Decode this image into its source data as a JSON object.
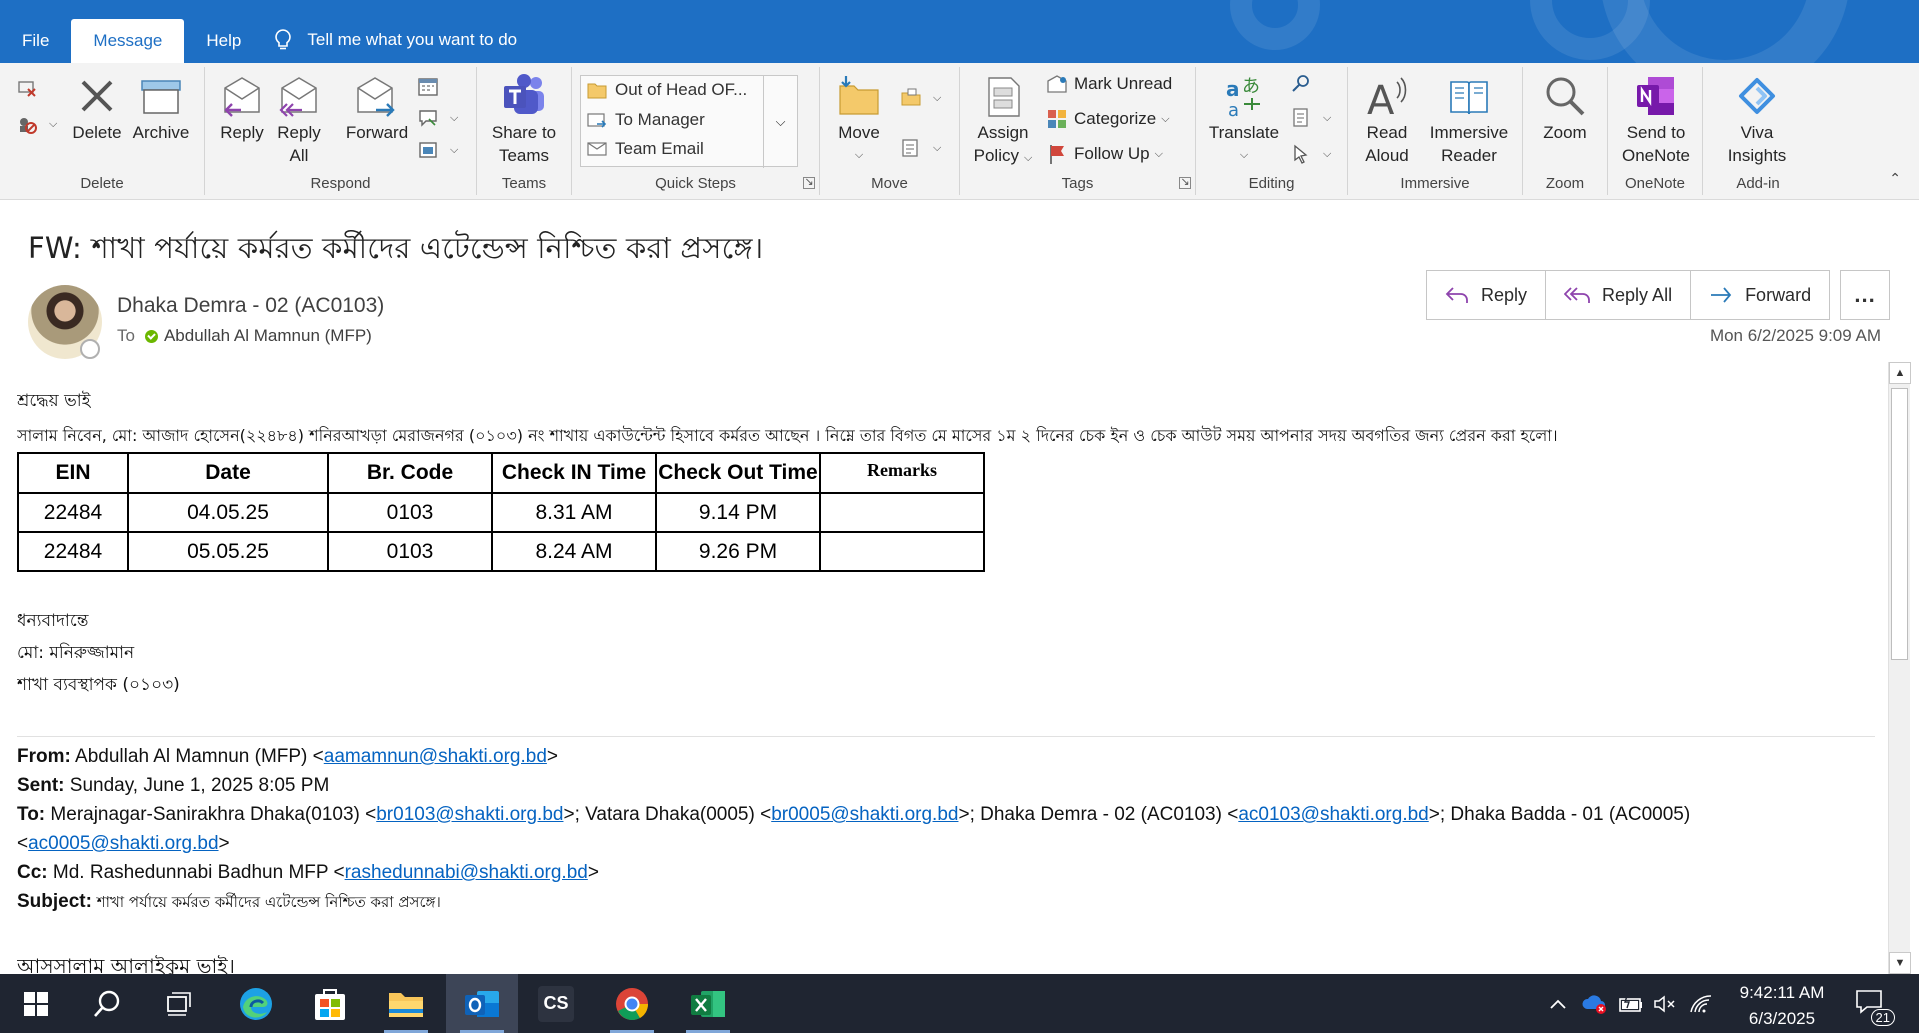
{
  "menu": {
    "file": "File",
    "message": "Message",
    "help": "Help",
    "tell_me": "Tell me what you want to do"
  },
  "ribbon": {
    "delete_group": {
      "label": "Delete",
      "delete": "Delete",
      "archive": "Archive"
    },
    "respond_group": {
      "label": "Respond",
      "reply": "Reply",
      "reply_all_1": "Reply",
      "reply_all_2": "All",
      "forward": "Forward"
    },
    "teams_group": {
      "label": "Teams",
      "share_1": "Share to",
      "share_2": "Teams"
    },
    "quick_steps_group": {
      "label": "Quick Steps",
      "items": [
        "Out of Head OF...",
        "To Manager",
        "Team Email"
      ]
    },
    "move_group": {
      "label": "Move",
      "move": "Move"
    },
    "tags_group": {
      "label": "Tags",
      "assign_1": "Assign",
      "assign_2": "Policy",
      "mark_unread": "Mark Unread",
      "categorize": "Categorize",
      "follow_up": "Follow Up"
    },
    "editing_group": {
      "label": "Editing",
      "translate": "Translate"
    },
    "immersive_group": {
      "label": "Immersive",
      "read_1": "Read",
      "read_2": "Aloud",
      "reader_1": "Immersive",
      "reader_2": "Reader"
    },
    "zoom_group": {
      "label": "Zoom",
      "zoom": "Zoom"
    },
    "onenote_group": {
      "label": "OneNote",
      "send_1": "Send to",
      "send_2": "OneNote"
    },
    "addin_group": {
      "label": "Add-in",
      "viva_1": "Viva",
      "viva_2": "Insights"
    }
  },
  "message": {
    "subject": "FW: শাখা পর্যায়ে কর্মরত কর্মীদের এটেন্ডেন্স নিশ্চিত করা প্রসঙ্গে।",
    "sender": "Dhaka Demra - 02 (AC0103)",
    "to_label": "To",
    "to": "Abdullah Al Mamnun (MFP)",
    "date": "Mon 6/2/2025 9:09 AM",
    "actions": {
      "reply": "Reply",
      "reply_all": "Reply All",
      "forward": "Forward",
      "more": "..."
    }
  },
  "body": {
    "greeting": "শ্রদ্ধেয় ভাই",
    "intro": "সালাম নিবেন, মো: আজাদ হোসেন(২২৪৮৪) শনিরআখড়া মেরাজনগর (০১০৩) নং শাখায় একাউন্টেন্ট হিসাবে কর্মরত আছেন । নিম্নে তার বিগত মে মাসের ১ম ২ দিনের চেক ইন ও চেক আউট সময় আপনার সদয় অবগতির জন্য প্রেরন করা হলো।",
    "table": {
      "headers": [
        "EIN",
        "Date",
        "Br. Code",
        "Check IN Time",
        "Check Out Time",
        "Remarks"
      ],
      "rows": [
        [
          "22484",
          "04.05.25",
          "0103",
          "8.31 AM",
          "9.14 PM",
          ""
        ],
        [
          "22484",
          "05.05.25",
          "0103",
          "8.24 AM",
          "9.26 PM",
          ""
        ]
      ]
    },
    "thanks": "ধন্যবাদান্তে",
    "signer": "মো: মনিরুজ্জামান",
    "signer_title": "শাখা ব্যবস্থাপক (০১০৩)",
    "fwd": {
      "from_label": "From:",
      "from_name": " Abdullah Al Mamnun (MFP) <",
      "from_email": "aamamnun@shakti.org.bd",
      "sent_label": "Sent:",
      "sent_value": " Sunday, June 1, 2025 8:05 PM",
      "to_label": "To:",
      "to_1_name": " Merajnagar-Sanirakhra Dhaka(0103) <",
      "to_1_email": "br0103@shakti.org.bd",
      "to_2_name": ">; Vatara Dhaka(0005) <",
      "to_2_email": "br0005@shakti.org.bd",
      "to_3_name": ">; Dhaka Demra - 02 (AC0103) <",
      "to_3_email": "ac0103@shakti.org.bd",
      "to_4_name": ">; Dhaka Badda - 01 (AC0005)",
      "to_4_email": "ac0005@shakti.org.bd",
      "cc_label": "Cc:",
      "cc_name": " Md. Rashedunnabi Badhun MFP <",
      "cc_email": "rashedunnabi@shakti.org.bd",
      "subject_label": "Subject:",
      "subject_value": " শাখা পর্যায়ে কর্মরত কর্মীদের এটেন্ডেন্স নিশ্চিত করা প্রসঙ্গে।",
      "salutation": "আসসালাম আলাইকুম ভাই।"
    }
  },
  "taskbar": {
    "time": "9:42:11 AM",
    "date": "6/3/2025",
    "notifications": "21",
    "cs_label": "CS"
  },
  "colors": {
    "title_blue": "#1e6fc4",
    "link": "#0563c1",
    "taskbar": "#1f2531"
  }
}
